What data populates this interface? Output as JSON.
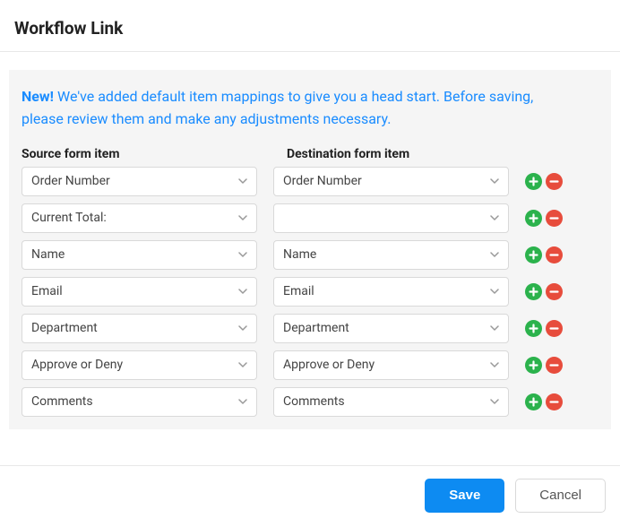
{
  "title": "Workflow Link",
  "notice": {
    "badge": "New!",
    "text": "We've added default item mappings to give you a head start. Before saving, please review them and make any adjustments necessary."
  },
  "columns": {
    "source_label": "Source form item",
    "dest_label": "Destination form item"
  },
  "mappings": [
    {
      "source": "Order Number",
      "dest": "Order Number"
    },
    {
      "source": "Current Total:",
      "dest": ""
    },
    {
      "source": "Name",
      "dest": "Name"
    },
    {
      "source": "Email",
      "dest": "Email"
    },
    {
      "source": "Department",
      "dest": "Department"
    },
    {
      "source": "Approve or Deny",
      "dest": "Approve or Deny"
    },
    {
      "source": "Comments",
      "dest": "Comments"
    }
  ],
  "footer": {
    "save": "Save",
    "cancel": "Cancel"
  }
}
